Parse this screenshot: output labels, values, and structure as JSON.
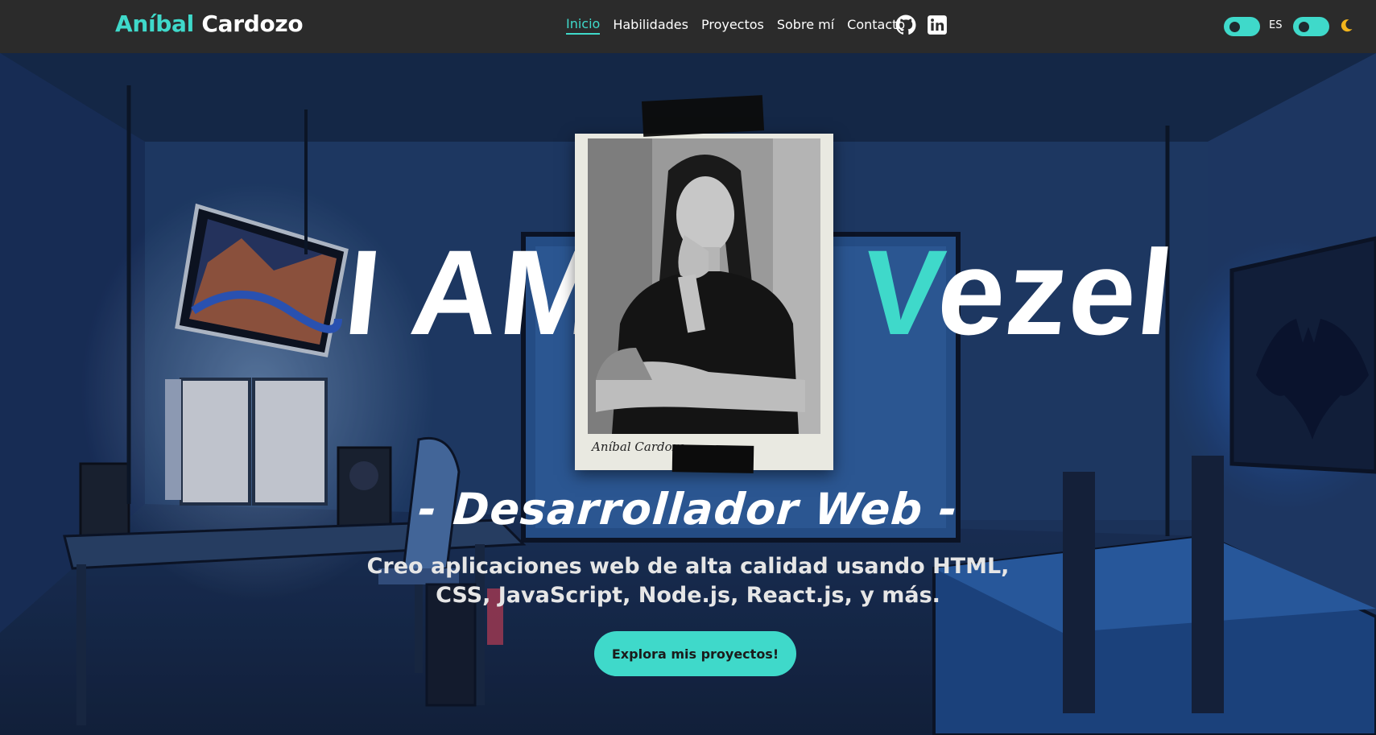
{
  "navbar": {
    "brand_first": "Aníbal",
    "brand_last": "Cardozo",
    "links": [
      {
        "label": "Inicio",
        "active": true
      },
      {
        "label": "Habilidades",
        "active": false
      },
      {
        "label": "Proyectos",
        "active": false
      },
      {
        "label": "Sobre mí",
        "active": false
      },
      {
        "label": "Contacto",
        "active": false
      }
    ],
    "social": {
      "github_icon": "github-icon",
      "linkedin_icon": "linkedin-icon"
    },
    "language_label": "ES",
    "theme_icon": "moon-icon"
  },
  "hero": {
    "big_left": "I AM",
    "big_right_accent": "V",
    "big_right_rest": "ezel",
    "photo_caption": "Aníbal Cardozo",
    "subtitle": "- Desarrollador Web -",
    "description_line1": "Creo aplicaciones web de alta calidad usando HTML,",
    "description_line2": "CSS, JavaScript, Node.js, React.js, y más.",
    "cta_label": "Explora mis proyectos!"
  },
  "colors": {
    "accent": "#3fd9ca",
    "navbar_bg": "#2b2b2b",
    "text_light": "#ffffff"
  }
}
